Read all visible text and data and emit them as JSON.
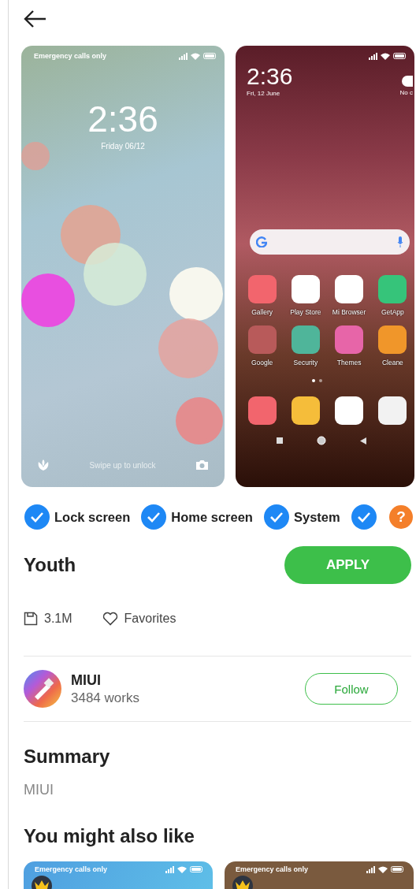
{
  "previews": [
    {
      "kind": "lock",
      "status": "Emergency calls only",
      "time": "2:36",
      "date": "Friday 06/12",
      "hint": "Swipe up to unlock"
    },
    {
      "kind": "home",
      "time": "2:36",
      "date": "Fri, 12 June",
      "weather": "No c",
      "apps": [
        {
          "label": "Gallery",
          "color": "#f2656d"
        },
        {
          "label": "Play Store",
          "color": "#ffffff"
        },
        {
          "label": "Mi Browser",
          "color": "#ffffff"
        },
        {
          "label": "GetApp",
          "color": "#36c47a"
        },
        {
          "label": "Google",
          "color": "#b85a5a"
        },
        {
          "label": "Security",
          "color": "#4fb59a"
        },
        {
          "label": "Themes",
          "color": "#e765a8"
        },
        {
          "label": "Cleane",
          "color": "#f0962a"
        }
      ],
      "dock": [
        {
          "color": "#f2656d"
        },
        {
          "color": "#f5bd3a"
        },
        {
          "color": "#ffffff"
        },
        {
          "color": "#f2f2f2"
        }
      ]
    }
  ],
  "components": [
    {
      "kind": "check",
      "label": "Lock screen",
      "checked": true
    },
    {
      "kind": "check",
      "label": "Home screen",
      "checked": true
    },
    {
      "kind": "check",
      "label": "System",
      "checked": true
    },
    {
      "kind": "check",
      "checked": true
    },
    {
      "kind": "help",
      "text": "?"
    }
  ],
  "theme": {
    "title": "Youth",
    "apply": "APPLY",
    "size": "3.1M",
    "favorites": "Favorites"
  },
  "author": {
    "name": "MIUI",
    "works": "3484 works",
    "follow": "Follow"
  },
  "summary": {
    "heading": "Summary",
    "text": "MIUI"
  },
  "related": {
    "heading": "You might also like",
    "items": [
      {
        "status": "Emergency calls only",
        "premium": true,
        "color": "#4f9fe0"
      },
      {
        "status": "Emergency calls only",
        "premium": true,
        "color": "#7a5a3e"
      }
    ]
  }
}
